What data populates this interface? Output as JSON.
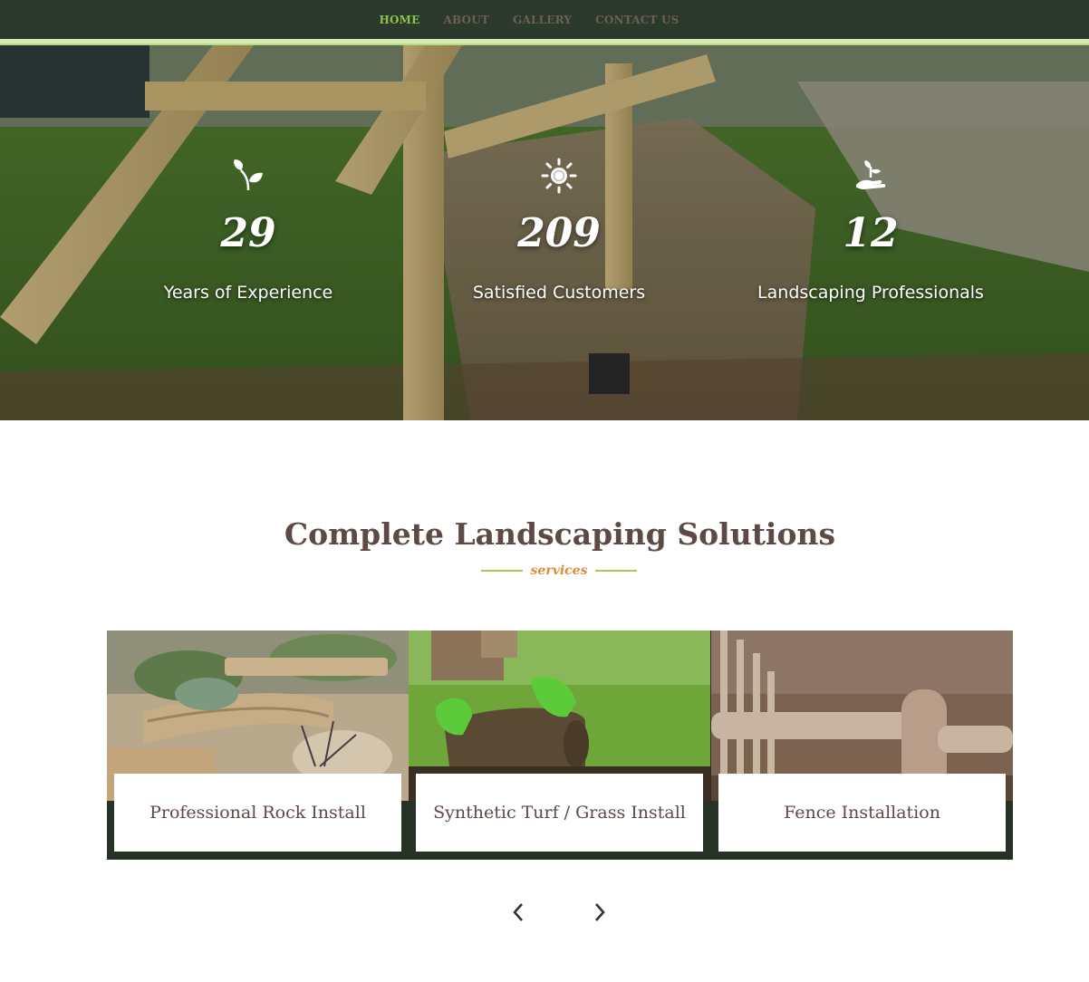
{
  "nav": {
    "items": [
      {
        "label": "HOME",
        "active": true
      },
      {
        "label": "ABOUT",
        "active": false
      },
      {
        "label": "GALLERY",
        "active": false
      },
      {
        "label": "CONTACT US",
        "active": false
      }
    ]
  },
  "stats": [
    {
      "icon": "sprout-leaf-icon",
      "value": "29",
      "label": "Years of Experience"
    },
    {
      "icon": "sun-icon",
      "value": "209",
      "label": "Satisfied Customers"
    },
    {
      "icon": "hand-plant-icon",
      "value": "12",
      "label": "Landscaping Professionals"
    }
  ],
  "services": {
    "title": "Complete Landscaping Solutions",
    "subtitle": "services",
    "cards": [
      {
        "label": "Professional Rock Install",
        "image": "rock-install-photo"
      },
      {
        "label": "Synthetic Turf / Grass Install",
        "image": "turf-install-photo"
      },
      {
        "label": "Fence Installation",
        "image": "fence-photo"
      }
    ],
    "prev_icon": "chevron-left-icon",
    "next_icon": "chevron-right-icon"
  },
  "colors": {
    "nav_bg": "#2b3a2c",
    "nav_active": "#8bc34a",
    "nav_inactive": "#6b6151",
    "heading": "#5d4a45",
    "subtitle": "#e08a3c",
    "divider": "#a8c74d",
    "card_band": "#263226"
  }
}
